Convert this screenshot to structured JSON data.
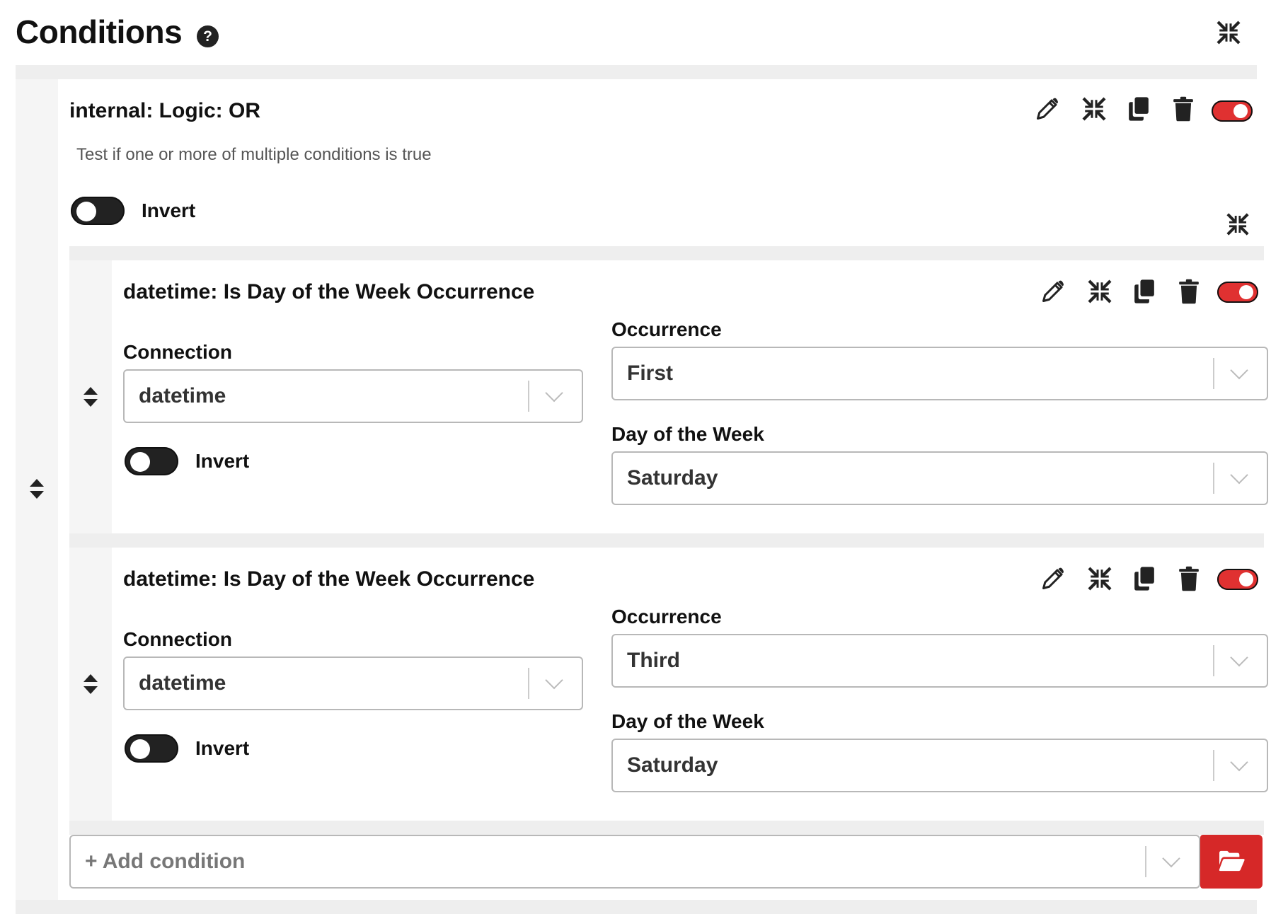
{
  "header": {
    "title": "Conditions",
    "help_glyph": "?"
  },
  "logic": {
    "title": "internal: Logic: OR",
    "description": "Test if one or more of multiple conditions is true",
    "invert_label": "Invert",
    "invert_on": false,
    "enabled": true
  },
  "conditions": [
    {
      "title": "datetime: Is Day of the Week Occurrence",
      "connection_label": "Connection",
      "connection_value": "datetime",
      "occurrence_label": "Occurrence",
      "occurrence_value": "First",
      "day_label": "Day of the Week",
      "day_value": "Saturday",
      "invert_label": "Invert",
      "invert_on": false,
      "enabled": true
    },
    {
      "title": "datetime: Is Day of the Week Occurrence",
      "connection_label": "Connection",
      "connection_value": "datetime",
      "occurrence_label": "Occurrence",
      "occurrence_value": "Third",
      "day_label": "Day of the Week",
      "day_value": "Saturday",
      "invert_label": "Invert",
      "invert_on": false,
      "enabled": true
    }
  ],
  "add_condition": {
    "placeholder": "+ Add condition"
  },
  "colors": {
    "accent": "#e03131",
    "button_red": "#d62828",
    "dark": "#222222",
    "panel_gray": "#eeeeee"
  },
  "icons": [
    "help-icon",
    "collapse-icon",
    "edit-icon",
    "copy-icon",
    "trash-icon",
    "drag-handle-icon",
    "chevron-down-icon",
    "folder-open-icon"
  ]
}
